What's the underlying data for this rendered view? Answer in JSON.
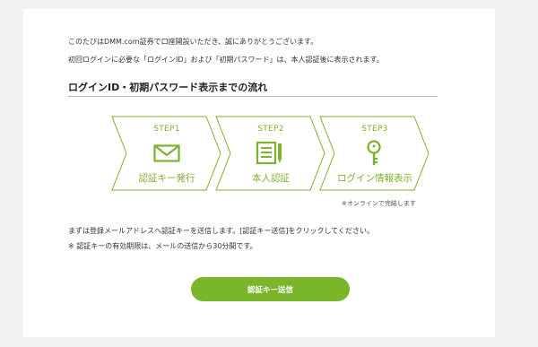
{
  "intro": {
    "line1": "このたびはDMM.com証券で口座開設いただき、誠にありがとうございます。",
    "line2": "初回ログインに必要な「ログインID」および「初期パスワード」は、本人認証後に表示されます。"
  },
  "section": {
    "title": "ログインID・初期パスワード表示までの流れ"
  },
  "steps": [
    {
      "label": "STEP1",
      "caption": "認証キー発行",
      "icon": "envelope-icon"
    },
    {
      "label": "STEP2",
      "caption": "本人認証",
      "icon": "document-pen-icon"
    },
    {
      "label": "STEP3",
      "caption": "ログイン情報表示",
      "icon": "key-icon"
    }
  ],
  "online_note": "※オンラインで完結します",
  "instructions": {
    "line1": "まずは登録メールアドレスへ認証キーを送信します。[認証キー送信]をクリックしてください。",
    "line2": "※ 認証キーの有効期限は、メールの送信から30分間です。"
  },
  "send_button": {
    "label": "認証キー送信"
  },
  "colors": {
    "accent": "#7ab62a",
    "background": "#f2f2f2",
    "card": "#ffffff"
  }
}
